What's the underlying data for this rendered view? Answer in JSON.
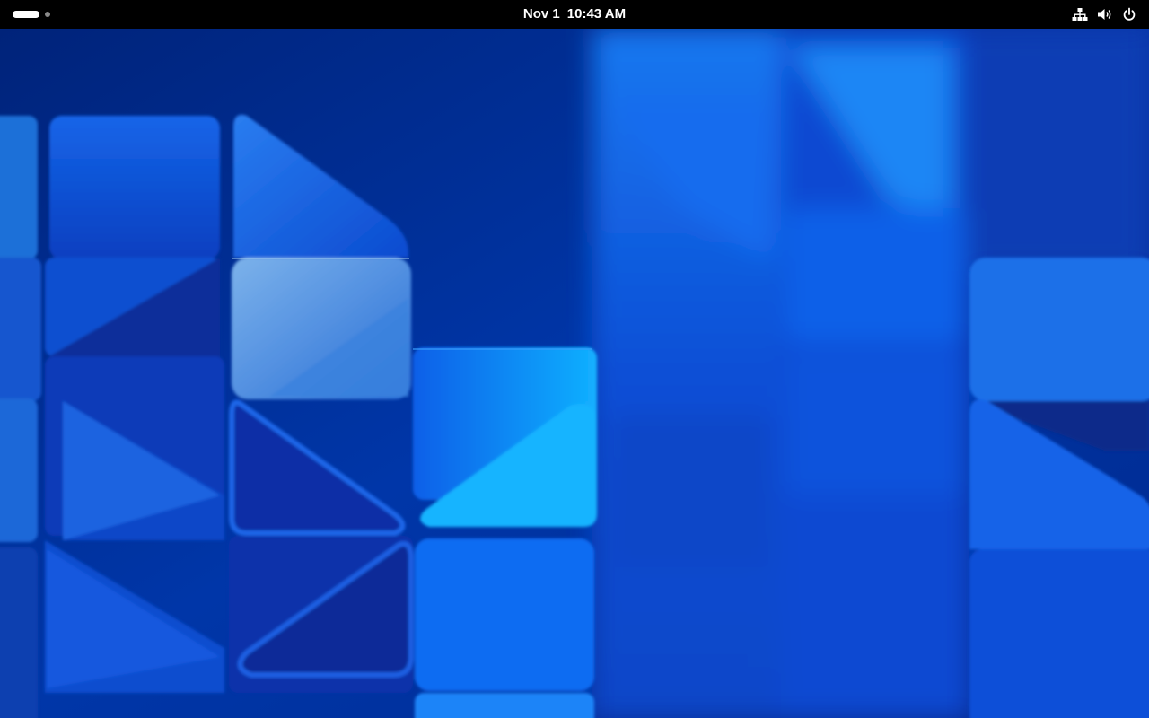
{
  "topbar": {
    "date": "Nov 1",
    "time": "10:43 AM",
    "tray_icons": [
      "network-icon",
      "volume-icon",
      "power-icon"
    ]
  },
  "colors": {
    "topbar": "#000000",
    "wallpaper_dark": "#001a66",
    "wallpaper_mid": "#0a4fd8",
    "wallpaper_light": "#2a8cff"
  }
}
